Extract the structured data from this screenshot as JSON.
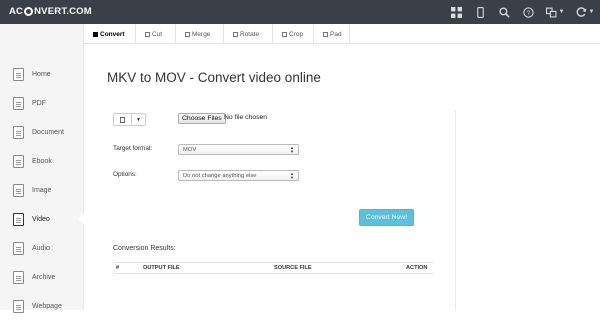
{
  "header": {
    "logo_prefix": "AC",
    "logo_suffix": "NVERT.COM",
    "icons": [
      "apps-grid-icon",
      "mobile-icon",
      "search-icon",
      "help-icon",
      "language-icon",
      "sync-icon"
    ]
  },
  "tabs": [
    {
      "label": "Convert",
      "active": true
    },
    {
      "label": "Cut",
      "active": false
    },
    {
      "label": "Merge",
      "active": false
    },
    {
      "label": "Rotate",
      "active": false
    },
    {
      "label": "Crop",
      "active": false
    },
    {
      "label": "Pad",
      "active": false
    }
  ],
  "sidebar": {
    "items": [
      {
        "label": "Home"
      },
      {
        "label": "PDF"
      },
      {
        "label": "Document"
      },
      {
        "label": "Ebook"
      },
      {
        "label": "Image"
      },
      {
        "label": "Video",
        "active": true
      },
      {
        "label": "Audio"
      },
      {
        "label": "Archive"
      },
      {
        "label": "Webpage"
      }
    ]
  },
  "main": {
    "title": "MKV to MOV - Convert video online",
    "file_tail": "·",
    "choose_files": "Choose Files",
    "no_file": "No file chosen",
    "target_format_label": "Target format:",
    "target_format_value": "MOV",
    "options_label": "Options:",
    "options_value": "Do not change anything else",
    "convert_button": "Convert Now!",
    "results_label": "Conversion Results:",
    "columns": [
      "#",
      "OUTPUT FILE",
      "SOURCE FILE",
      "ACTION"
    ]
  },
  "colors": {
    "topbar": "#3a3f48",
    "accent": "#5bc0de",
    "sidebar_bg": "#f5f5f5"
  }
}
